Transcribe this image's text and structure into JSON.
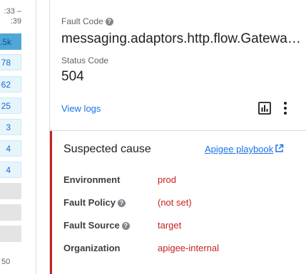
{
  "sidebar": {
    "time_top": ":33 –",
    "time_bottom": ":39",
    "time_footer": "50",
    "cells": [
      {
        "value": ".5k",
        "state": "selected"
      },
      {
        "value": "78",
        "state": "light"
      },
      {
        "value": "62",
        "state": "light"
      },
      {
        "value": "25",
        "state": "light"
      },
      {
        "value": "3",
        "state": "light"
      },
      {
        "value": "4",
        "state": "light"
      },
      {
        "value": "4",
        "state": "light"
      },
      {
        "value": "",
        "state": "gray"
      },
      {
        "value": "",
        "state": "gray"
      },
      {
        "value": "",
        "state": "gray"
      }
    ]
  },
  "detail": {
    "fault_code_label": "Fault Code",
    "fault_code_value": "messaging.adaptors.http.flow.GatewayTimeout",
    "status_code_label": "Status Code",
    "status_code_value": "504",
    "view_logs_label": "View logs",
    "chart_icon": "bar-chart-icon",
    "more_icon": "more-vert-icon"
  },
  "cause": {
    "title": "Suspected cause",
    "playbook_link": "Apigee playbook",
    "rows": [
      {
        "label": "Environment",
        "value": "prod",
        "help": false
      },
      {
        "label": "Fault Policy",
        "value": "(not set)",
        "help": true
      },
      {
        "label": "Fault Source",
        "value": "target",
        "help": true
      },
      {
        "label": "Organization",
        "value": "apigee-internal",
        "help": false
      }
    ]
  },
  "colors": {
    "accent": "#1a73e8",
    "error": "#c5221f",
    "selected_cell": "#4fa7d6",
    "light_cell": "#e6f5fc"
  }
}
